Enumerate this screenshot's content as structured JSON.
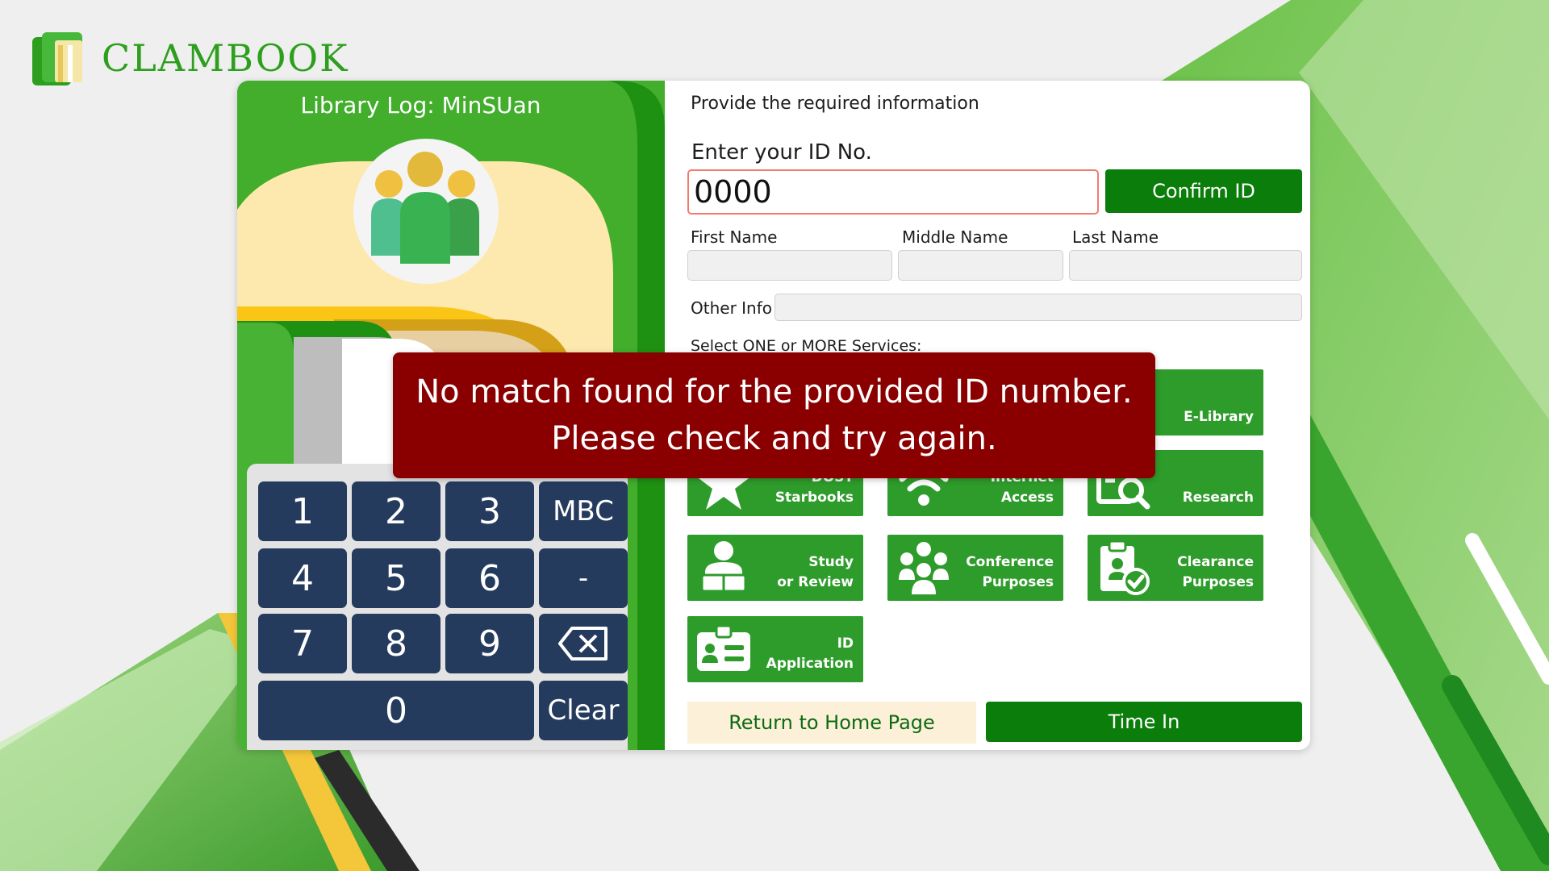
{
  "brand": {
    "name": "CLAMBOOK",
    "logo_icon": "book-stack-icon"
  },
  "left": {
    "title": "Library Log: MinSUan",
    "avatar_icon": "people-group-icon",
    "keypad": {
      "keys": [
        "1",
        "2",
        "3",
        "MBC",
        "4",
        "5",
        "6",
        "-",
        "7",
        "8",
        "9",
        "0",
        "Clear"
      ],
      "backspace_icon": "backspace-icon"
    }
  },
  "form": {
    "heading": "Provide the required information",
    "id_label": "Enter your ID No.",
    "id_value": "0000",
    "confirm_label": "Confirm ID",
    "first_name_label": "First Name",
    "middle_name_label": "Middle Name",
    "last_name_label": "Last Name",
    "other_info_label": "Other Info",
    "services_label": "Select ONE or MORE Services:",
    "services": [
      {
        "label": "E-Library",
        "icon": "e-library-icon"
      },
      {
        "label": "DOST Starbooks",
        "line1": "DOST",
        "line2": "Starbooks",
        "icon": "star-icon"
      },
      {
        "label": "Internet Access",
        "line1": "Internet",
        "line2": "Access",
        "icon": "wifi-icon"
      },
      {
        "label": "Research",
        "icon": "search-document-icon"
      },
      {
        "label": "Study or Review",
        "line1": "Study",
        "line2": "or Review",
        "icon": "reader-icon"
      },
      {
        "label": "Conference Purposes",
        "line1": "Conference",
        "line2": "Purposes",
        "icon": "group-icon"
      },
      {
        "label": "Clearance Purposes",
        "line1": "Clearance",
        "line2": "Purposes",
        "icon": "clipboard-check-icon"
      },
      {
        "label": "ID Application",
        "line1": "ID",
        "line2": "Application",
        "icon": "id-card-icon"
      }
    ],
    "return_label": "Return to Home Page",
    "time_in_label": "Time In"
  },
  "toast": {
    "line1": "No match found for the provided ID number.",
    "line2": "Please check and try again."
  },
  "colors": {
    "accent_green": "#0a7d0a",
    "service_green": "#2e9c2a",
    "keypad_blue": "#253b5e",
    "error_red": "#8a0000",
    "cream": "#fdf0d8"
  }
}
